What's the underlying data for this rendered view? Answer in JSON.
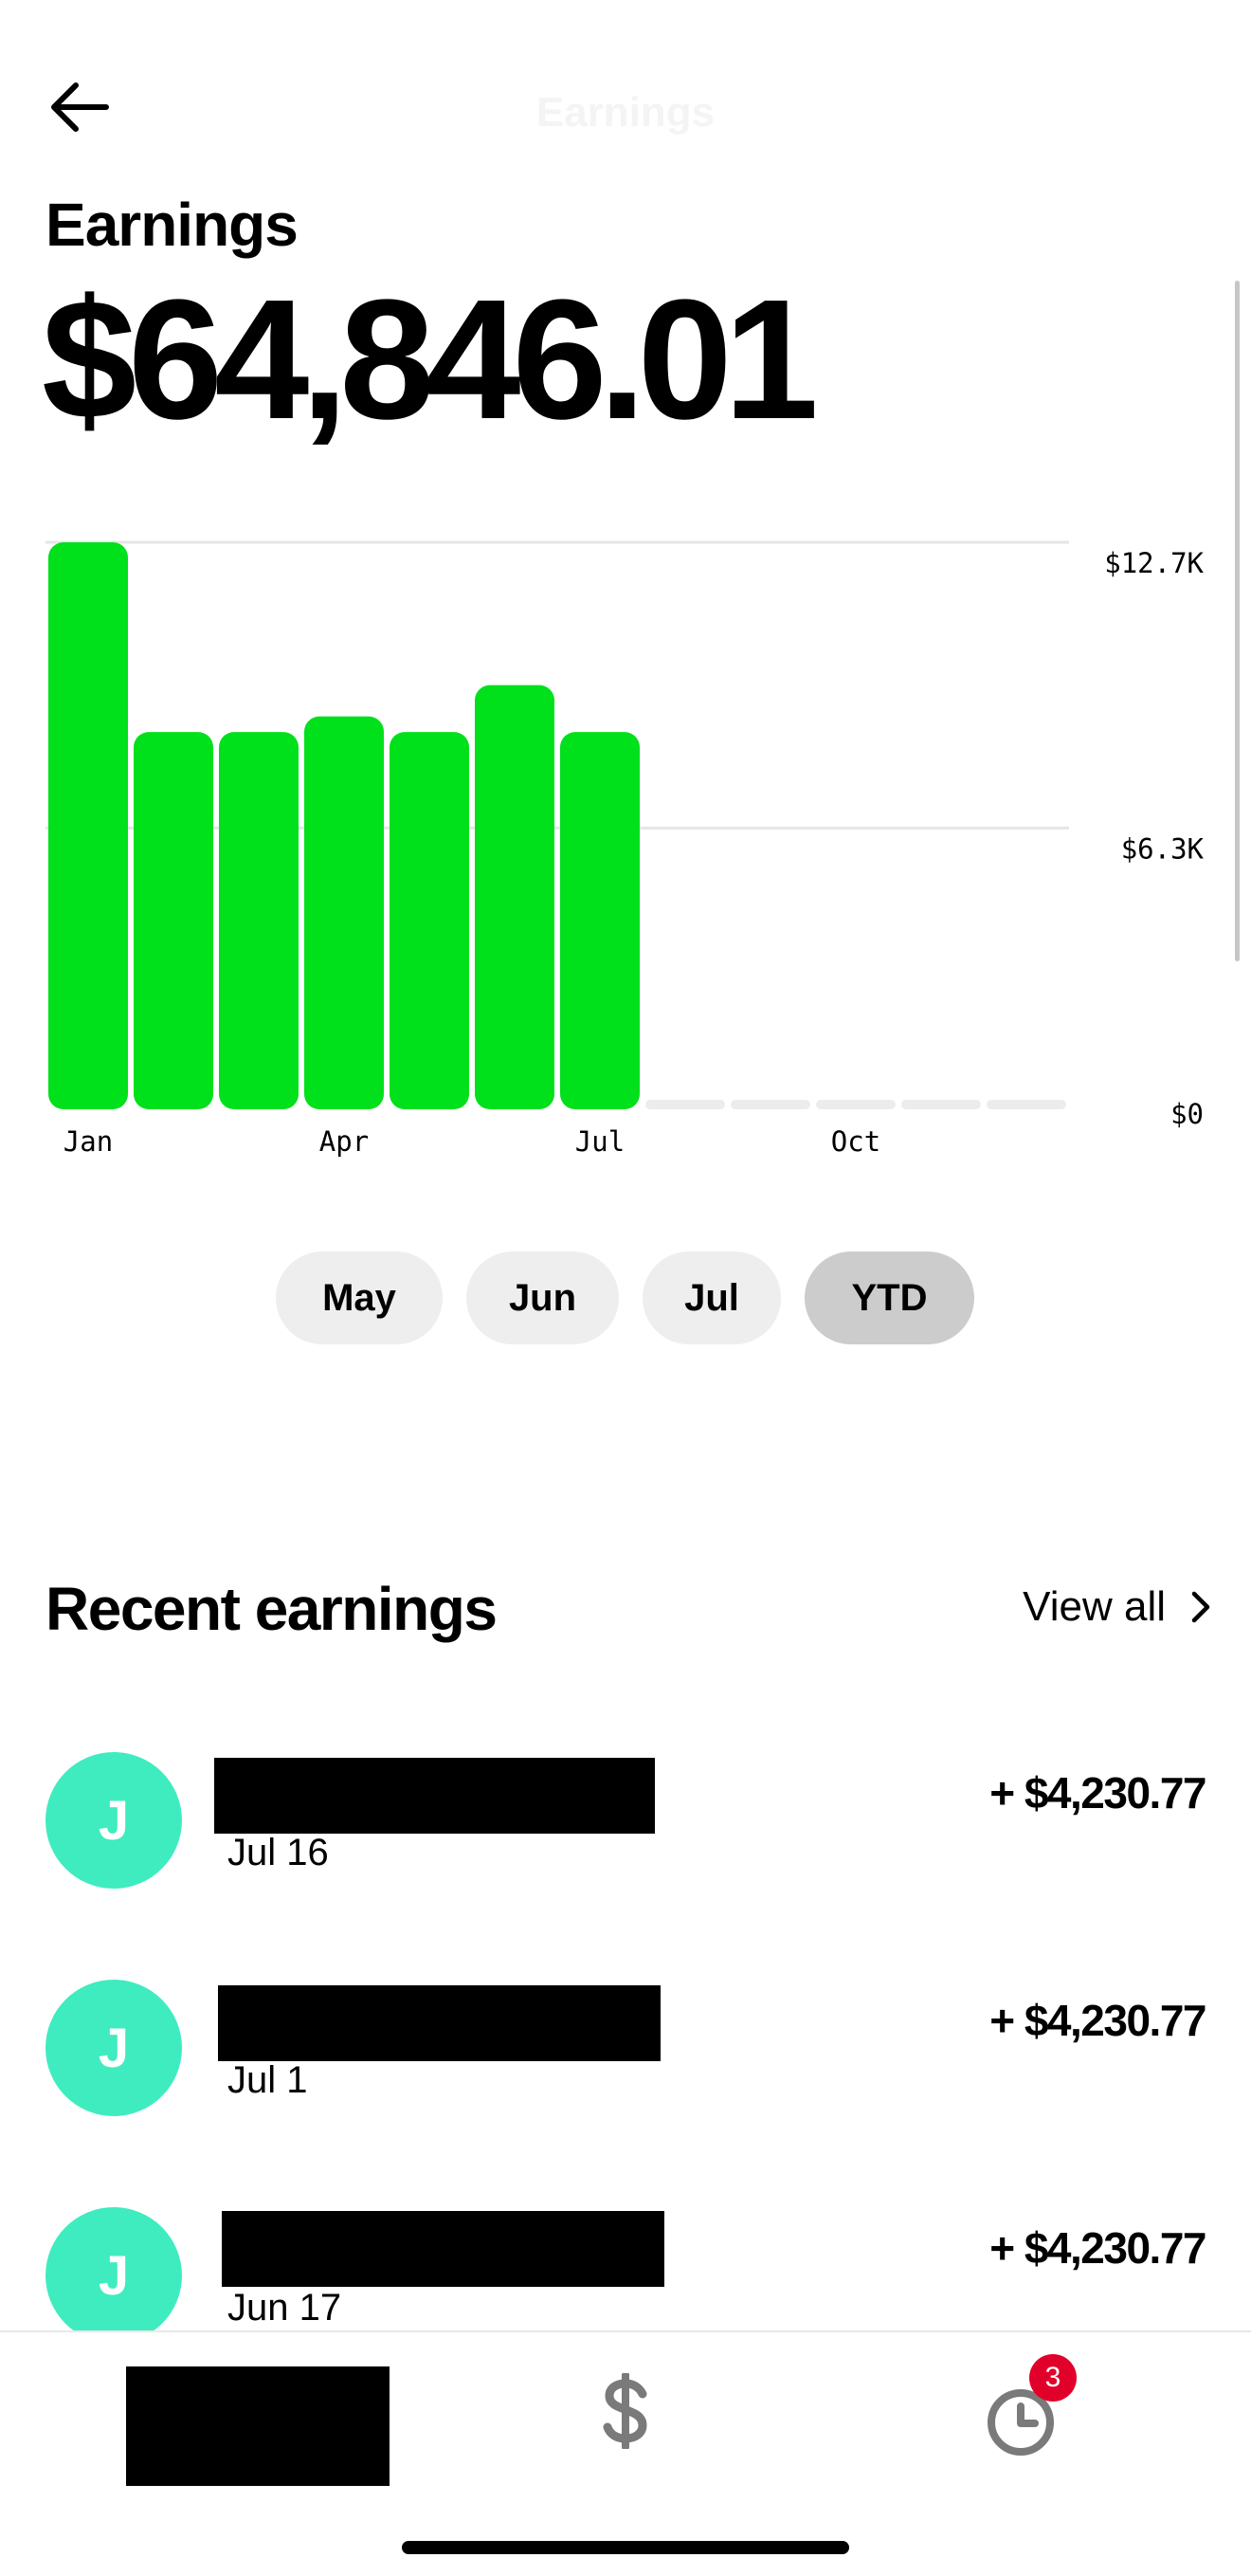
{
  "header": {
    "nav_title": "Earnings",
    "page_title": "Earnings",
    "total": "$64,846.01"
  },
  "chart_data": {
    "type": "bar",
    "categories": [
      "Jan",
      "Feb",
      "Mar",
      "Apr",
      "May",
      "Jun",
      "Jul",
      "Aug",
      "Sep",
      "Oct",
      "Nov",
      "Dec"
    ],
    "values": [
      12700,
      8450,
      8450,
      8800,
      8450,
      9500,
      8450,
      0,
      0,
      0,
      0,
      0
    ],
    "x_tick_labels": [
      "Jan",
      "",
      "",
      "Apr",
      "",
      "",
      "Jul",
      "",
      "",
      "Oct",
      "",
      ""
    ],
    "y_ticks": [
      12700,
      6300,
      0
    ],
    "y_tick_labels": [
      "$12.7K",
      "$6.3K",
      "$0"
    ],
    "ylim": [
      0,
      12700
    ],
    "grid": true,
    "colors": {
      "bar": "#00e01b",
      "empty_bar": "#ececec",
      "grid": "#e6e6e6"
    }
  },
  "periods": [
    {
      "label": "May",
      "active": false
    },
    {
      "label": "Jun",
      "active": false
    },
    {
      "label": "Jul",
      "active": false
    },
    {
      "label": "YTD",
      "active": true
    }
  ],
  "recent": {
    "title": "Recent earnings",
    "view_all": "View all",
    "items": [
      {
        "initial": "J",
        "date": "Jul 16",
        "amount": "+ $4,230.77"
      },
      {
        "initial": "J",
        "date": "Jul 1",
        "amount": "+ $4,230.77"
      },
      {
        "initial": "J",
        "date": "Jun 17",
        "amount": "+ $4,230.77"
      }
    ]
  },
  "tabbar": {
    "money_icon": "dollar-icon",
    "activity_icon": "clock-icon",
    "badge": "3"
  }
}
